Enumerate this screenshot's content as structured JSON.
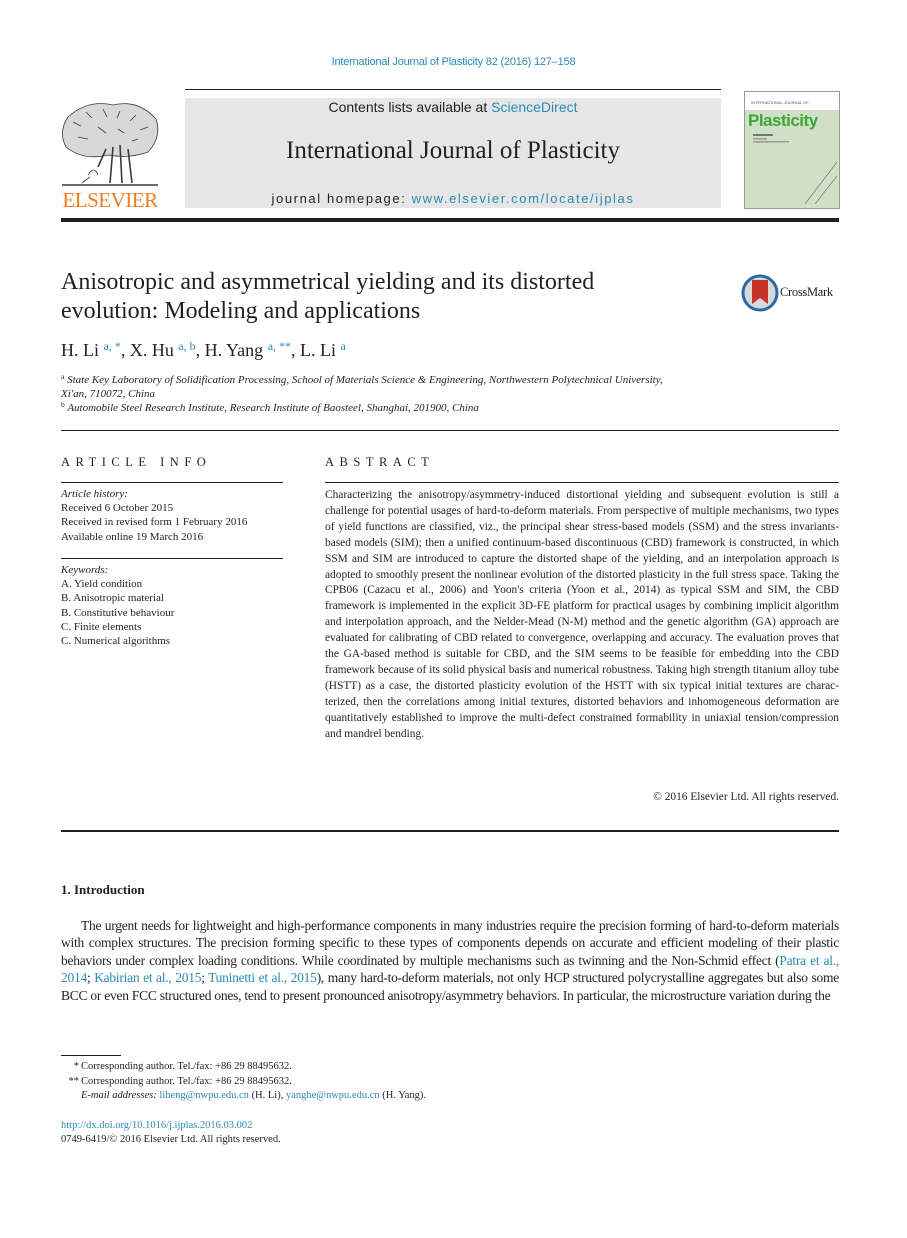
{
  "citation": "International Journal of Plasticity 82 (2016) 127–158",
  "header": {
    "publisher": "ELSEVIER",
    "contents_prefix": "Contents lists available at ",
    "contents_link": "ScienceDirect",
    "journal_title": "International Journal of Plasticity",
    "homepage_prefix": "journal homepage: ",
    "homepage_link": "www.elsevier.com/locate/ijplas",
    "cover_title": "Plasticity",
    "cover_header": "INTERNATIONAL JOURNAL OF"
  },
  "colors": {
    "link": "#2a8ab8",
    "elsevier_orange": "#f07c21",
    "banner_gray": "#e6e6e6",
    "cover_green": "#3fa53a",
    "crossmark_red": "#c4342b"
  },
  "article": {
    "title_line1": "Anisotropic and asymmetrical yielding and its distorted",
    "title_line2": "evolution: Modeling and applications",
    "crossmark": "CrossMark",
    "authors": [
      {
        "name": "H. Li",
        "sup": "a, *",
        "sep": ", "
      },
      {
        "name": "X. Hu",
        "sup": "a, b",
        "sep": ", "
      },
      {
        "name": "H. Yang",
        "sup": "a, **",
        "sep": ", "
      },
      {
        "name": "L. Li",
        "sup": "a",
        "sep": ""
      }
    ],
    "affiliations": [
      {
        "mark": "a",
        "line1": "State Key Laboratory of Solidification Processing, School of Materials Science & Engineering, Northwestern Polytechnical University,",
        "line2": "Xi'an, 710072, China"
      },
      {
        "mark": "b",
        "line1": "Automobile Steel Research Institute, Research Institute of Baosteel, Shanghai, 201900, China",
        "line2": ""
      }
    ]
  },
  "article_info": {
    "label": "ARTICLE INFO",
    "history_head": "Article history:",
    "history": [
      "Received 6 October 2015",
      "Received in revised form 1 February 2016",
      "Available online 19 March 2016"
    ],
    "keywords_head": "Keywords:",
    "keywords": [
      "A. Yield condition",
      "B. Anisotropic material",
      "B. Constitutive behaviour",
      "C. Finite elements",
      "C. Numerical algorithms"
    ]
  },
  "abstract": {
    "label": "ABSTRACT",
    "text": "Characterizing the anisotropy/asymmetry-induced distortional yielding and subsequent evolution is still a challenge for potential usages of hard-to-deform materials. From perspective of multiple mechanisms, two types of yield functions are classified, viz., the principal shear stress-based models (SSM) and the stress invariants-based models (SIM); then a unified continuum-based discontinuous (CBD) framework is constructed, in which SSM and SIM are introduced to capture the distorted shape of the yielding, and an inter­polation approach is adopted to smoothly present the nonlinear evolution of the distorted plasticity in the full stress space. Taking the CPB06 (Cazacu et al., 2006) and Yoon's criteria (Yoon et al., 2014) as typical SSM and SIM, the CBD framework is implemented in the explicit 3D-FE platform for practical usages by combining implicit algorithm and inter­polation approach, and the Nelder-Mead (N-M) method and the genetic algorithm (GA) approach are evaluated for calibrating of CBD related to convergence, overlapping and accuracy. The evaluation proves that the GA-based method is suitable for CBD, and the SIM seems to be feasible for embedding into the CBD framework because of its solid physical basis and numerical robustness. Taking high strength titanium alloy tube (HSTT) as a case, the distorted plasticity evolution of the HSTT with six typical initial textures are charac­terized, then the correlations among initial textures, distorted behaviors and inhomoge­neous deformation are quantitatively established to improve the multi-defect constrained formability in uniaxial tension/compression and mandrel bending.",
    "copyright": "© 2016 Elsevier Ltd. All rights reserved."
  },
  "introduction": {
    "heading": "1.  Introduction",
    "text_part1": "The urgent needs for lightweight and high-performance components in many industries require the precision forming of hard-to-deform materials with complex structures. The precision forming specific to these types of components depends on accurate and efficient modeling of their plastic behaviors under complex loading conditions. While coordinated by multiple mechanisms such as twinning and the Non-Schmid effect (",
    "refs": [
      "Patra et al., 2014",
      "Kabirian et al., 2015",
      "Tuninetti et al., 2015"
    ],
    "text_part2": "), many hard-to-deform materials, not only HCP structured polycrystalline aggregates but also some BCC or even FCC structured ones, tend to present pronounced anisotropy/asymmetry behaviors. In particular, the microstructure variation during the"
  },
  "footnotes": {
    "note1_mark": "*",
    "note1": "Corresponding author. Tel./fax: +86 29 88495632.",
    "note2_mark": "**",
    "note2": "Corresponding author. Tel./fax: +86 29 88495632.",
    "email_label": "E-mail addresses: ",
    "email1": "liheng@nwpu.edu.cn",
    "email1_owner": " (H. Li), ",
    "email2": "yanghe@nwpu.edu.cn",
    "email2_owner": " (H. Yang).",
    "doi": "http://dx.doi.org/10.1016/j.ijplas.2016.03.002",
    "issn": "0749-6419/© 2016 Elsevier Ltd. All rights reserved."
  }
}
